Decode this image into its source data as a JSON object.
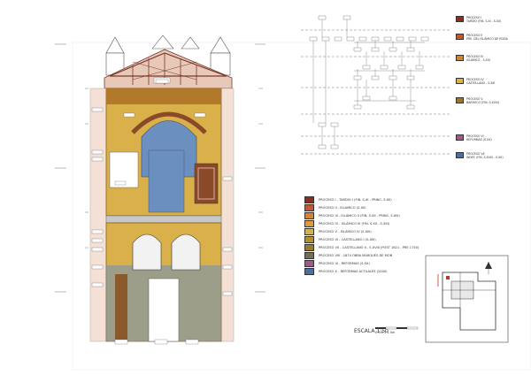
{
  "colors": {
    "yellow": "#d9b04a",
    "blue": "#6b8fbf",
    "brown": "#8a4a2a",
    "pink": "#e8c8b8",
    "red": "#c0392b",
    "orange": "#d8842e",
    "olive": "#9a7a2a"
  },
  "legend": [
    {
      "label": "PROCESO I - TARDÍO I (FIN. S.XI - PRINC. S.XII)",
      "color": "#8a2e1e"
    },
    {
      "label": "PROCESO II - ISLÁMICO (S.XII)",
      "color": "#c45a2a"
    },
    {
      "label": "PROCESO III - ISLÁMICO II (FIN. S.XII - PRINC. S.XIII)",
      "color": "#d8842e"
    },
    {
      "label": "PROCESO IV - ISLÁMICO III (FIN. S.XII - S.XIII)",
      "color": "#e09a3a"
    },
    {
      "label": "PROCESO V - ISLÁMICO IV (S.XIII)",
      "color": "#d9b04a"
    },
    {
      "label": "PROCESO VI - CASTELLANO I (S.XIII)",
      "color": "#b8902a"
    },
    {
      "label": "PROCESO VII - CASTELLANO II - S.XVIII (POST 1621 - PRE 1750)",
      "color": "#9a7a2a"
    },
    {
      "label": "PROCESO VIII - 1874 OBRA MARQUÉS DE MON",
      "color": "#7a6a5a"
    },
    {
      "label": "PROCESO IX - REFORMAS (S.XX)",
      "color": "#a05a8a"
    },
    {
      "label": "PROCESO X - REFORMAS ACTUALES (2000)",
      "color": "#4a6fa8"
    }
  ],
  "harris_keys": [
    {
      "label": "PROCESO I\nTARDÍO (FIN. S.XI - S.XII)",
      "color": "#8a2e1e"
    },
    {
      "label": "PROCESO II\nPRE. DEL ISLÁMICO DE RODA",
      "color": "#c45a2a"
    },
    {
      "label": "PROCESO III\nISLÁMICO - S.XIII",
      "color": "#d8842e"
    },
    {
      "label": "PROCESO IV\nCASTELLANO - S.XIII",
      "color": "#d9b04a"
    },
    {
      "label": "PROCESO V\nBARROCO (FIN. S.XVIII)",
      "color": "#9a7a2a"
    },
    {
      "label": "PROCESO VI\nREFORMAS (S.XX)",
      "color": "#a05a8a"
    },
    {
      "label": "PROCESO VII\nINDEF. (FIN. S.XVIII - S.XX)",
      "color": "#4a6fa8"
    }
  ],
  "scale": {
    "label": "ESCALA 1:50",
    "ticks": "0    0.5    1    1.5m"
  }
}
